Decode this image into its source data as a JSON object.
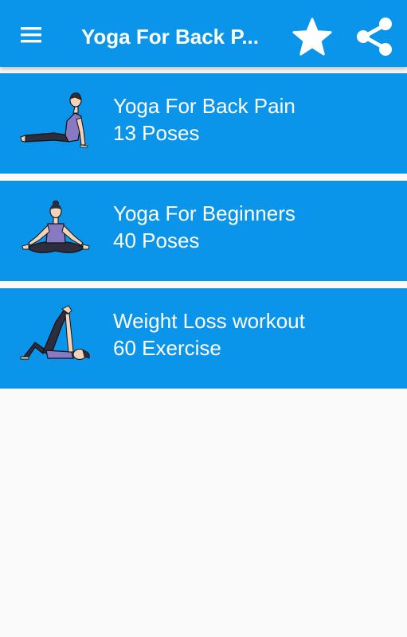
{
  "app_bar": {
    "title": "Yoga For Back P...",
    "icons": {
      "menu": "hamburger-menu-icon",
      "favorite": "star-icon",
      "share": "share-icon"
    }
  },
  "programs": [
    {
      "title": "Yoga For Back Pain",
      "subtitle": "13 Poses",
      "image": "cobra-pose"
    },
    {
      "title": "Yoga For Beginners",
      "subtitle": "40 Poses",
      "image": "lotus-pose"
    },
    {
      "title": "Weight Loss workout",
      "subtitle": "60 Exercise",
      "image": "leg-stretch-pose"
    }
  ],
  "colors": {
    "primary": "#0b95ea",
    "background": "#fafafa",
    "text_on_primary": "#ffffff",
    "figure_top": "#8879c3",
    "figure_pants": "#2d2d3d",
    "figure_skin": "#f3d2b7"
  }
}
